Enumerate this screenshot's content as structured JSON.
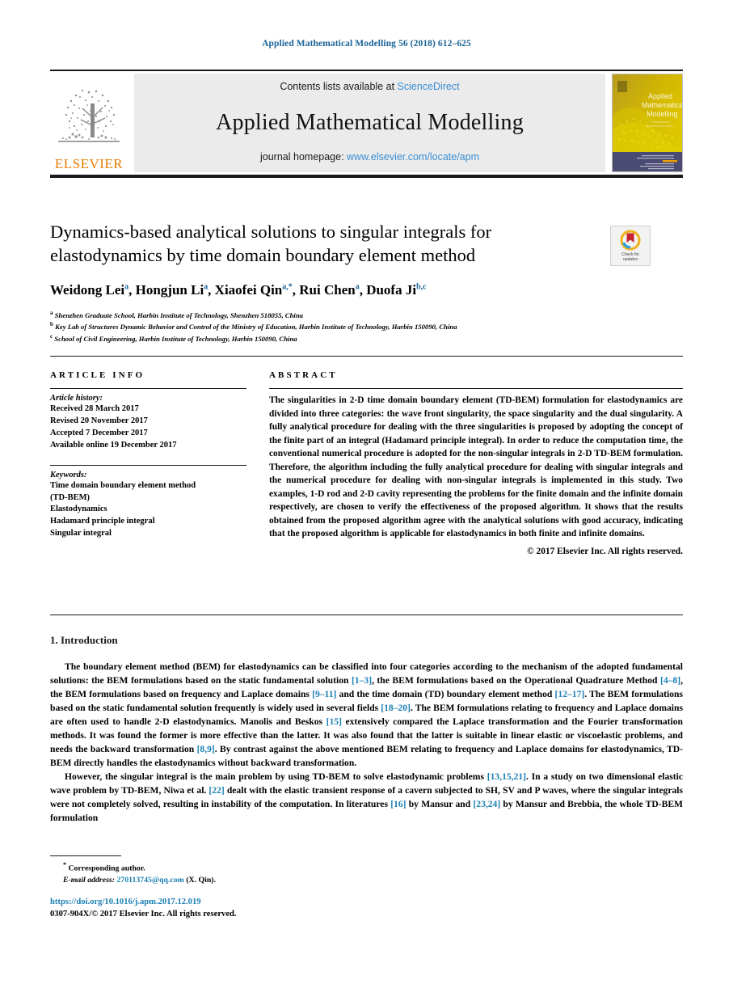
{
  "running_head": "Applied Mathematical Modelling 56 (2018) 612–625",
  "masthead": {
    "contents_prefix": "Contents lists available at ",
    "contents_link": "ScienceDirect",
    "journal_title": "Applied Mathematical Modelling",
    "homepage_prefix": "journal homepage: ",
    "homepage_link": "www.elsevier.com/locate/apm",
    "publisher_logo_text": "ELSEVIER",
    "cover_title_line1": "Applied",
    "cover_title_line2": "Mathematical",
    "cover_title_line3": "Modelling"
  },
  "article": {
    "title": "Dynamics-based analytical solutions to singular integrals for elastodynamics by time domain boundary element method",
    "authors_html": "Weidong Lei<sup>a</sup>, Hongjun Li<sup>a</sup>, Xiaofei Qin<sup>a,<span class=\"star\">*</span></sup>, Rui Chen<sup>a</sup>, Duofa Ji<sup>b,c</sup>",
    "affiliations": [
      {
        "marker": "a",
        "text": "Shenzhen Graduate School, Harbin Institute of Technology, Shenzhen 518055, China"
      },
      {
        "marker": "b",
        "text": "Key Lab of Structures Dynamic Behavior and Control of the Ministry of Education, Harbin Institute of Technology, Harbin 150090, China"
      },
      {
        "marker": "c",
        "text": "School of Civil Engineering, Harbin Institute of Technology, Harbin 150090, China"
      }
    ]
  },
  "crossmark": {
    "line1": "Check for",
    "line2": "updates"
  },
  "article_info": {
    "heading": "ARTICLE INFO",
    "history_label": "Article history:",
    "history": [
      "Received 28 March 2017",
      "Revised 20 November 2017",
      "Accepted 7 December 2017",
      "Available online 19 December 2017"
    ],
    "keywords_label": "Keywords:",
    "keywords": [
      "Time domain boundary element method",
      "(TD-BEM)",
      "Elastodynamics",
      "Hadamard principle integral",
      "Singular integral"
    ]
  },
  "abstract": {
    "heading": "ABSTRACT",
    "body": "The singularities in 2-D time domain boundary element (TD-BEM) formulation for elastodynamics are divided into three categories: the wave front singularity, the space singularity and the dual singularity. A fully analytical procedure for dealing with the three singularities is proposed by adopting the concept of the finite part of an integral (Hadamard principle integral). In order to reduce the computation time, the conventional numerical procedure is adopted for the non-singular integrals in 2-D TD-BEM formulation. Therefore, the algorithm including the fully analytical procedure for dealing with singular integrals and the numerical procedure for dealing with non-singular integrals is implemented in this study. Two examples, 1-D rod and 2-D cavity representing the problems for the finite domain and the infinite domain respectively, are chosen to verify the effectiveness of the proposed algorithm. It shows that the results obtained from the proposed algorithm agree with the analytical solutions with good accuracy, indicating that the proposed algorithm is applicable for elastodynamics in both finite and infinite domains.",
    "copyright": "© 2017 Elsevier Inc. All rights reserved."
  },
  "introduction": {
    "heading": "1. Introduction",
    "paragraph1_html": "The boundary element method (BEM) for elastodynamics can be classified into four categories according to the mechanism of the adopted fundamental solutions: the BEM formulations based on the static fundamental solution <span class=\"ref\">[1–3]</span>, the BEM formulations based on the Operational Quadrature Method <span class=\"ref\">[4–8]</span>, the BEM formulations based on frequency and Laplace domains <span class=\"ref\">[9–11]</span> and the time domain (TD) boundary element method <span class=\"ref\">[12–17]</span>. The BEM formulations based on the static fundamental solution frequently is widely used in several fields <span class=\"ref\">[18–20]</span>. The BEM formulations relating to frequency and Laplace domains are often used to handle 2-D elastodynamics. Manolis and Beskos <span class=\"ref\">[15]</span> extensively compared the Laplace transformation and the Fourier transformation methods. It was found the former is more effective than the latter. It was also found that the latter is suitable in linear elastic or viscoelastic problems, and needs the backward transformation <span class=\"ref\">[8,9]</span>. By contrast against the above mentioned BEM relating to frequency and Laplace domains for elastodynamics, TD-BEM directly handles the elastodynamics without backward transformation.",
    "paragraph2_html": "However, the singular integral is the main problem by using TD-BEM to solve elastodynamic problems <span class=\"ref\">[13,15,21]</span>. In a study on two dimensional elastic wave problem by TD-BEM, Niwa et al. <span class=\"ref\">[22]</span> dealt with the elastic transient response of a cavern subjected to SH, SV and P waves, where the singular integrals were not completely solved, resulting in instability of the computation. In literatures <span class=\"ref\">[16]</span> by Mansur and <span class=\"ref\">[23,24]</span> by Mansur and Brebbia, the whole TD-BEM formulation"
  },
  "footnote": {
    "corresponding": "Corresponding author.",
    "email_label": "E-mail address:",
    "email": "270113745@qq.com",
    "email_suffix": "(X. Qin)."
  },
  "footer": {
    "doi": "https://doi.org/10.1016/j.apm.2017.12.019",
    "issn_line": "0307-904X/© 2017 Elsevier Inc. All rights reserved."
  },
  "colors": {
    "link_blue": "#1a7fb3",
    "science_direct_blue": "#3b8fd4",
    "elsevier_orange": "#E87B00",
    "cover_gold": "#c6a400"
  }
}
